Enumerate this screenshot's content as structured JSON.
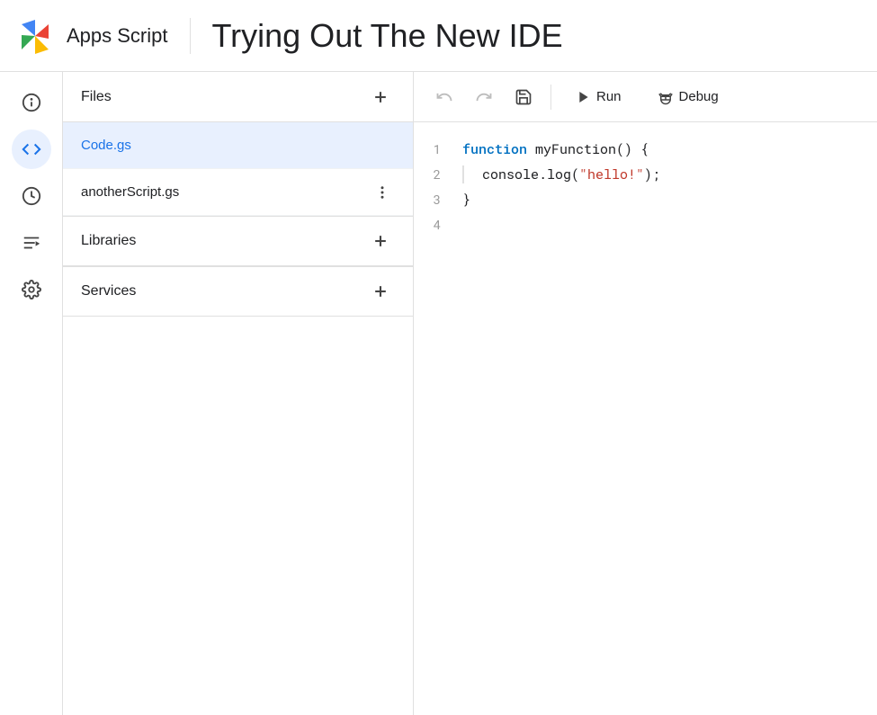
{
  "header": {
    "app_title": "Apps Script",
    "project_title": "Trying Out The New IDE"
  },
  "nav": {
    "items": [
      {
        "id": "info",
        "icon": "ℹ",
        "label": "about-icon",
        "active": false
      },
      {
        "id": "editor",
        "icon": "<>",
        "label": "editor-icon",
        "active": true
      },
      {
        "id": "clock",
        "icon": "⏰",
        "label": "triggers-icon",
        "active": false
      },
      {
        "id": "executions",
        "icon": "≡▶",
        "label": "executions-icon",
        "active": false
      },
      {
        "id": "settings",
        "icon": "⚙",
        "label": "settings-icon",
        "active": false
      }
    ]
  },
  "files_panel": {
    "title": "Files",
    "add_label": "+",
    "files": [
      {
        "name": "Code.gs",
        "active": true
      },
      {
        "name": "anotherScript.gs",
        "active": false
      }
    ]
  },
  "libraries_panel": {
    "title": "Libraries",
    "add_label": "+"
  },
  "services_panel": {
    "title": "Services",
    "add_label": "+"
  },
  "toolbar": {
    "undo_label": "↺",
    "redo_label": "↻",
    "save_label": "💾",
    "run_label": "Run",
    "debug_label": "Debug"
  },
  "code": {
    "lines": [
      {
        "num": "1",
        "content": "function myFunction() {"
      },
      {
        "num": "2",
        "content": "  console.log(\"hello!\");"
      },
      {
        "num": "3",
        "content": "}"
      },
      {
        "num": "4",
        "content": ""
      }
    ]
  },
  "colors": {
    "accent": "#1a73e8",
    "active_bg": "#e8f0fe",
    "keyword": "#0070c1",
    "string": "#c0392b"
  }
}
